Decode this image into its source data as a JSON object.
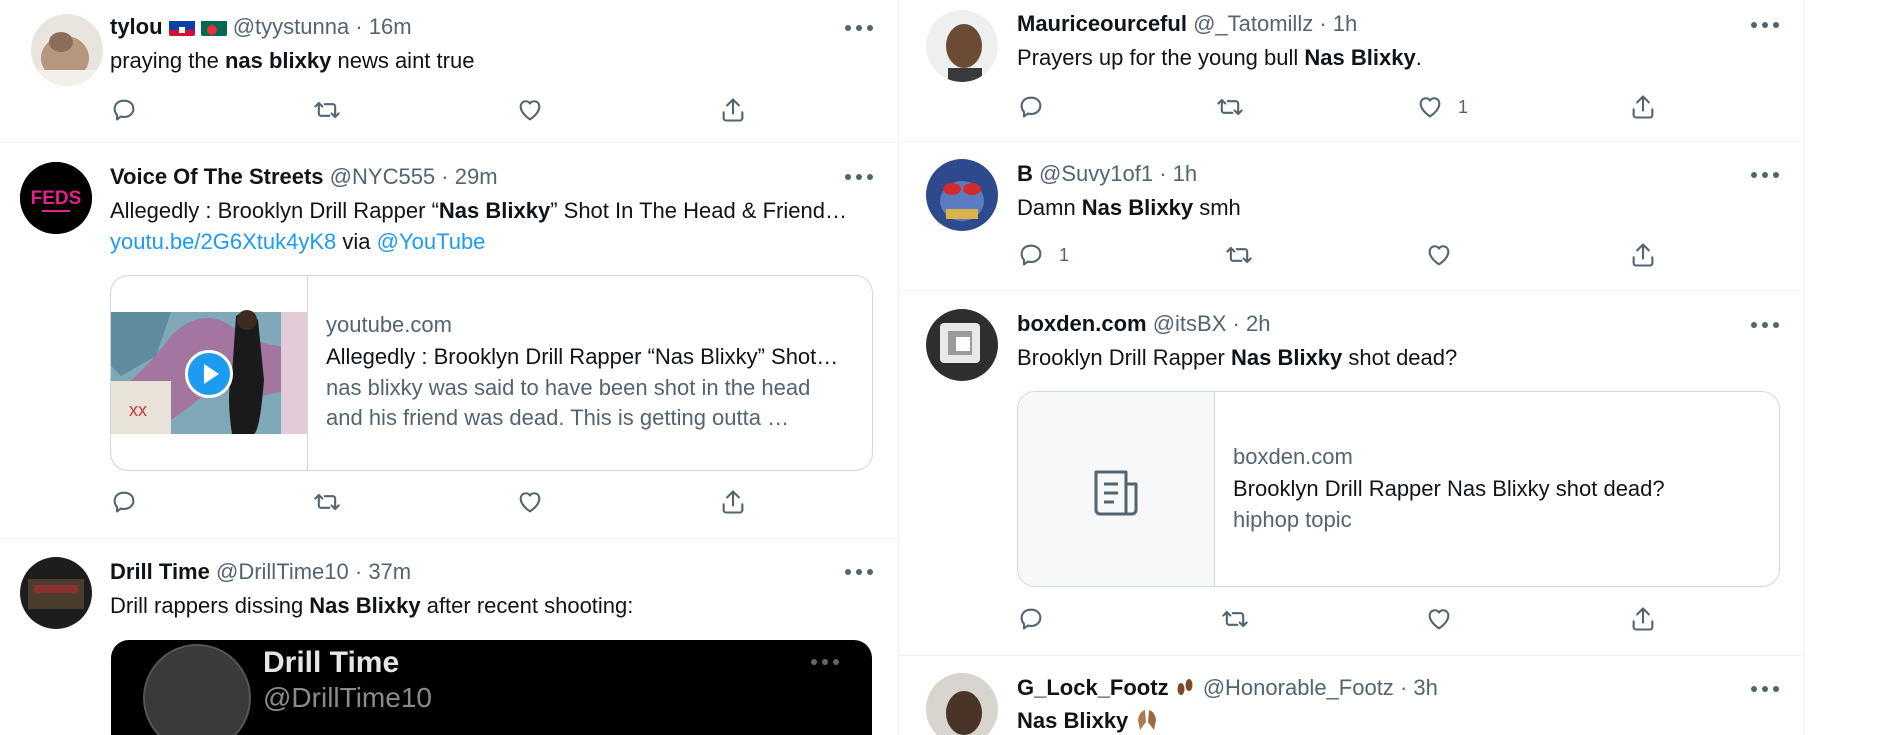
{
  "left_tweets": [
    {
      "name": "tylou",
      "handle": "@tyystunna",
      "time": "· 16m",
      "text_pre": "praying the ",
      "text_bold": "nas blixky",
      "text_post": " news aint true",
      "reply_count": "",
      "retweet_count": "",
      "like_count": ""
    },
    {
      "name": "Voice Of The Streets",
      "handle": "@NYC555",
      "time": "· 29m",
      "text_pre": "Allegedly : Brooklyn Drill Rapper “",
      "text_bold": "Nas Blixky",
      "text_post": "” Shot In The Head & Friend…",
      "link_text": "youtu.be/2G6Xtuk4yK8",
      "via_text": " via ",
      "mention_text": "@YouTube",
      "avatar_logo": "FEDS",
      "card": {
        "domain": "youtube.com",
        "title": "Allegedly : Brooklyn Drill Rapper “Nas Blixky” Shot…",
        "desc_line1": "nas blixky was said to have been shot in the head",
        "desc_line2": "and his friend was dead. This is getting outta …"
      }
    },
    {
      "name": "Drill Time",
      "handle": "@DrillTime10",
      "time": "· 37m",
      "text_pre": "Drill rappers dissing ",
      "text_bold": "Nas Blixky",
      "text_post": " after recent shooting:",
      "embed_name": "Drill Time",
      "embed_handle": "@DrillTime10"
    }
  ],
  "right_tweets": [
    {
      "name": "Mauriceourceful",
      "handle": "@_Tatomillz",
      "time": "· 1h",
      "text_pre": "Prayers up for the young bull ",
      "text_bold": "Nas Blixky",
      "text_post": ".",
      "reply_count": "",
      "retweet_count": "",
      "like_count": "1"
    },
    {
      "name": "B",
      "handle": "@Suvy1of1",
      "time": "· 1h",
      "text_pre": "Damn ",
      "text_bold": "Nas Blixky",
      "text_post": " smh",
      "reply_count": "1",
      "retweet_count": "",
      "like_count": ""
    },
    {
      "name": "boxden.com",
      "handle": "@itsBX",
      "time": "· 2h",
      "text_pre": "Brooklyn Drill Rapper ",
      "text_bold": "Nas Blixky",
      "text_post": " shot dead?",
      "card": {
        "domain": "boxden.com",
        "title": "Brooklyn Drill Rapper Nas Blixky shot dead?",
        "desc_line1": "hiphop topic"
      }
    },
    {
      "name": "G_Lock_Footz",
      "handle": "@Honorable_Footz",
      "time": "· 3h",
      "text_bold": "Nas Blixky"
    }
  ],
  "icons": {
    "reply": "reply-icon",
    "retweet": "retweet-icon",
    "like": "heart-icon",
    "share": "share-icon",
    "more": "more-icon",
    "play": "play-icon",
    "article": "article-icon"
  },
  "colors": {
    "accent": "#1d9bf0",
    "secondary_text": "#536471",
    "text": "#0f1419",
    "border": "#eff3f4"
  }
}
